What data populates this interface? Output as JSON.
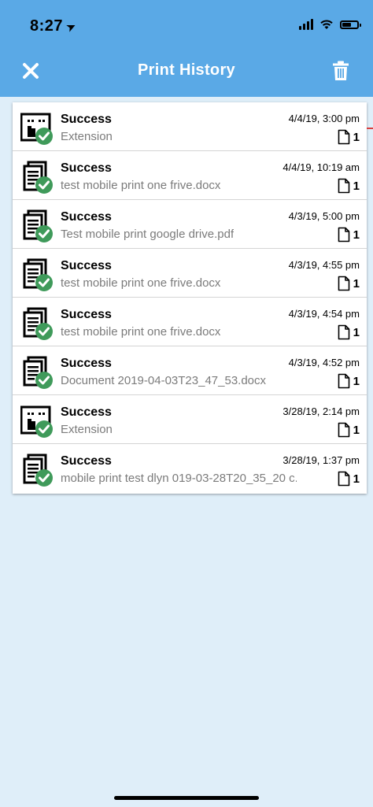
{
  "status_bar": {
    "time": "8:27"
  },
  "nav": {
    "title": "Print History"
  },
  "colors": {
    "accent": "#5aa9e6",
    "success_badge": "#3f9a5a",
    "background": "#dfeef9"
  },
  "print_jobs": [
    {
      "status": "Success",
      "name": "Extension",
      "date": "4/4/19, 3:00 pm",
      "pages": "1",
      "icon": "extension-job-icon"
    },
    {
      "status": "Success",
      "name": "test mobile print one frive.docx",
      "date": "4/4/19, 10:19 am",
      "pages": "1",
      "icon": "document-job-icon"
    },
    {
      "status": "Success",
      "name": "Test mobile print google drive.pdf",
      "date": "4/3/19, 5:00 pm",
      "pages": "1",
      "icon": "document-job-icon"
    },
    {
      "status": "Success",
      "name": "test mobile print one frive.docx",
      "date": "4/3/19, 4:55 pm",
      "pages": "1",
      "icon": "document-job-icon"
    },
    {
      "status": "Success",
      "name": "test mobile print one frive.docx",
      "date": "4/3/19, 4:54 pm",
      "pages": "1",
      "icon": "document-job-icon"
    },
    {
      "status": "Success",
      "name": "Document 2019-04-03T23_47_53.docx",
      "date": "4/3/19, 4:52 pm",
      "pages": "1",
      "icon": "document-job-icon"
    },
    {
      "status": "Success",
      "name": "Extension",
      "date": "3/28/19, 2:14 pm",
      "pages": "1",
      "icon": "extension-job-icon"
    },
    {
      "status": "Success",
      "name": "mobile print test dlyn 019-03-28T20_35_20 c...",
      "date": "3/28/19, 1:37 pm",
      "pages": "1",
      "icon": "document-job-icon"
    }
  ]
}
